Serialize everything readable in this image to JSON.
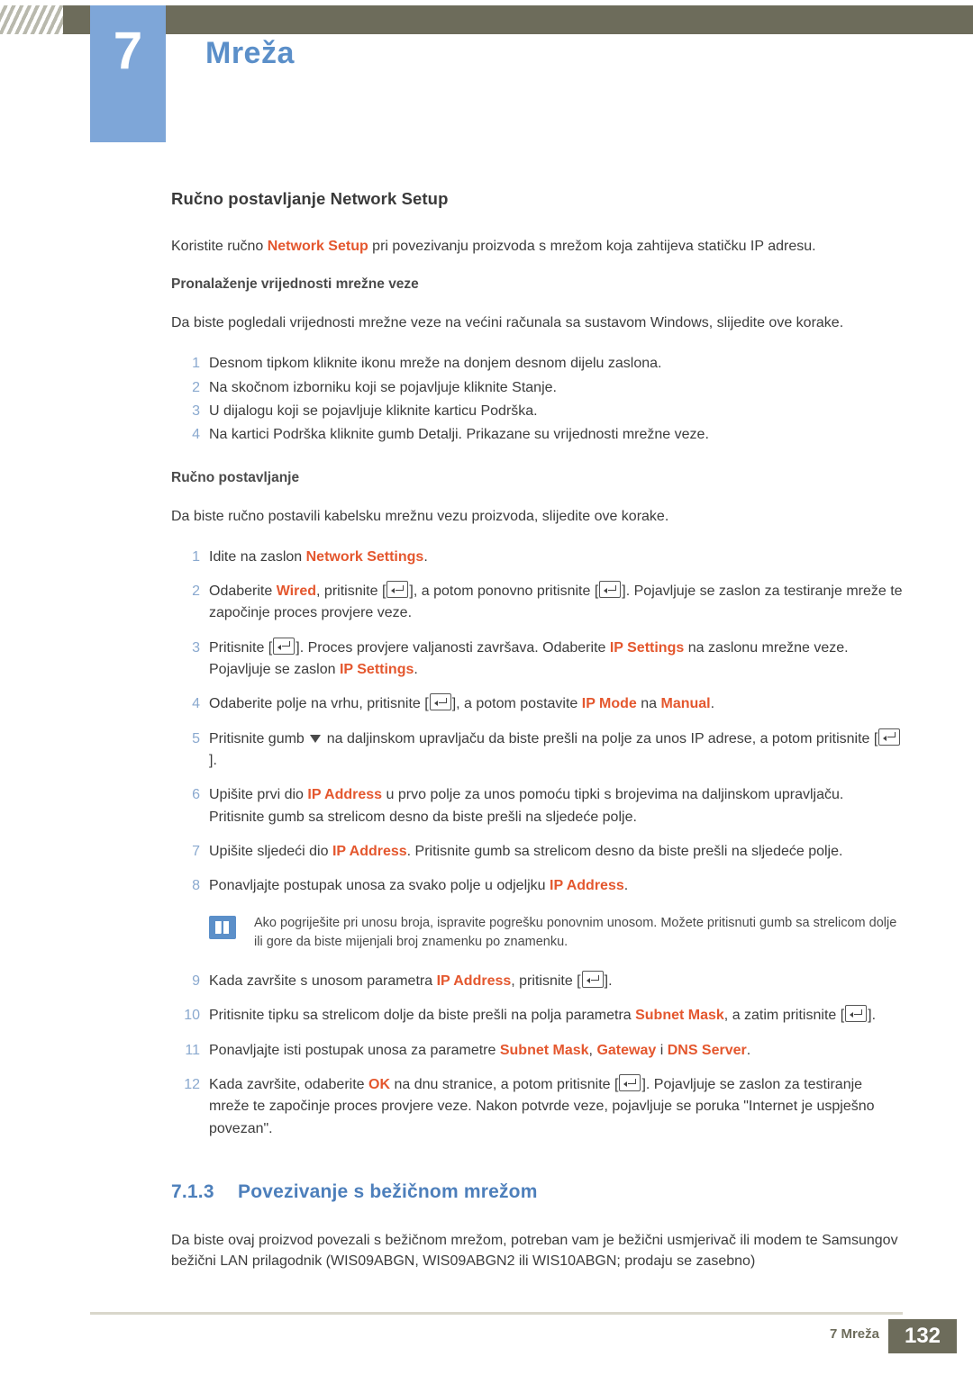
{
  "header": {
    "chapter_number": "7",
    "chapter_title": "Mreža"
  },
  "section": {
    "title": "Ručno postavljanje Network Setup",
    "intro_a": "Koristite ručno ",
    "intro_link": "Network Setup",
    "intro_b": " pri povezivanju proizvoda s mrežom koja zahtijeva statičku IP adresu."
  },
  "sub1": {
    "title": "Pronalaženje vrijednosti mrežne veze",
    "lead": "Da biste pogledali vrijednosti mrežne veze na većini računala sa sustavom Windows, slijedite ove korake.",
    "steps": [
      {
        "num": "1",
        "text": "Desnom tipkom kliknite ikonu mreže na donjem desnom dijelu zaslona."
      },
      {
        "num": "2",
        "text": "Na skočnom izborniku koji se pojavljuje kliknite Stanje."
      },
      {
        "num": "3",
        "text": "U dijalogu koji se pojavljuje kliknite karticu Podrška."
      },
      {
        "num": "4",
        "text": "Na kartici Podrška kliknite gumb Detalji. Prikazane su vrijednosti mrežne veze."
      }
    ]
  },
  "sub2": {
    "title": "Ručno postavljanje",
    "lead": "Da biste ručno postavili kabelsku mrežnu vezu proizvoda, slijedite ove korake.",
    "steps": [
      {
        "num": "1",
        "parts": [
          {
            "t": "Idite na zaslon ",
            "s": "plain"
          },
          {
            "t": "Network Settings",
            "s": "orange"
          },
          {
            "t": ".",
            "s": "plain"
          }
        ]
      },
      {
        "num": "2",
        "parts": [
          {
            "t": "Odaberite ",
            "s": "plain"
          },
          {
            "t": "Wired",
            "s": "orange"
          },
          {
            "t": ", pritisnite [",
            "s": "plain"
          },
          {
            "t": "",
            "s": "key"
          },
          {
            "t": "], a potom ponovno pritisnite [",
            "s": "plain"
          },
          {
            "t": "",
            "s": "key"
          },
          {
            "t": "]. Pojavljuje se zaslon za testiranje mreže te započinje proces provjere veze.",
            "s": "plain"
          }
        ]
      },
      {
        "num": "3",
        "parts": [
          {
            "t": "Pritisnite [",
            "s": "plain"
          },
          {
            "t": "",
            "s": "key"
          },
          {
            "t": "]. Proces provjere valjanosti završava. Odaberite ",
            "s": "plain"
          },
          {
            "t": "IP Settings",
            "s": "orange"
          },
          {
            "t": " na zaslonu mrežne veze. Pojavljuje se zaslon ",
            "s": "plain"
          },
          {
            "t": "IP Settings",
            "s": "orange"
          },
          {
            "t": ".",
            "s": "plain"
          }
        ]
      },
      {
        "num": "4",
        "parts": [
          {
            "t": "Odaberite polje na vrhu, pritisnite [",
            "s": "plain"
          },
          {
            "t": "",
            "s": "key"
          },
          {
            "t": "], a potom postavite ",
            "s": "plain"
          },
          {
            "t": "IP Mode",
            "s": "orange"
          },
          {
            "t": " na ",
            "s": "plain"
          },
          {
            "t": "Manual",
            "s": "orange"
          },
          {
            "t": ".",
            "s": "plain"
          }
        ]
      },
      {
        "num": "5",
        "parts": [
          {
            "t": "Pritisnite gumb ",
            "s": "plain"
          },
          {
            "t": "",
            "s": "down"
          },
          {
            "t": " na daljinskom upravljaču da biste prešli na polje za unos IP adrese, a potom pritisnite [",
            "s": "plain"
          },
          {
            "t": "",
            "s": "key"
          },
          {
            "t": "].",
            "s": "plain"
          }
        ]
      },
      {
        "num": "6",
        "parts": [
          {
            "t": "Upišite prvi dio ",
            "s": "plain"
          },
          {
            "t": "IP Address",
            "s": "orange"
          },
          {
            "t": " u prvo polje za unos pomoću tipki s brojevima na daljinskom upravljaču. Pritisnite gumb sa strelicom desno da biste prešli na sljedeće polje.",
            "s": "plain"
          }
        ]
      },
      {
        "num": "7",
        "parts": [
          {
            "t": "Upišite sljedeći dio ",
            "s": "plain"
          },
          {
            "t": "IP Address",
            "s": "orange"
          },
          {
            "t": ". Pritisnite gumb sa strelicom desno da biste prešli na sljedeće polje.",
            "s": "plain"
          }
        ]
      },
      {
        "num": "8",
        "parts": [
          {
            "t": "Ponavljajte postupak unosa za svako polje u odjeljku ",
            "s": "plain"
          },
          {
            "t": "IP Address",
            "s": "orange"
          },
          {
            "t": ".",
            "s": "plain"
          }
        ]
      }
    ],
    "note": "Ako pogriješite pri unosu broja, ispravite pogrešku ponovnim unosom. Možete pritisnuti gumb sa strelicom dolje ili gore da biste mijenjali broj znamenku po znamenku.",
    "steps2": [
      {
        "num": "9",
        "parts": [
          {
            "t": "Kada završite s unosom parametra ",
            "s": "plain"
          },
          {
            "t": "IP Address",
            "s": "orange"
          },
          {
            "t": ", pritisnite [",
            "s": "plain"
          },
          {
            "t": "",
            "s": "key"
          },
          {
            "t": "].",
            "s": "plain"
          }
        ]
      },
      {
        "num": "10",
        "parts": [
          {
            "t": "Pritisnite tipku sa strelicom dolje da biste prešli na polja parametra ",
            "s": "plain"
          },
          {
            "t": "Subnet Mask",
            "s": "orange"
          },
          {
            "t": ", a zatim pritisnite [",
            "s": "plain"
          },
          {
            "t": "",
            "s": "key"
          },
          {
            "t": "].",
            "s": "plain"
          }
        ]
      },
      {
        "num": "11",
        "parts": [
          {
            "t": "Ponavljajte isti postupak unosa za parametre ",
            "s": "plain"
          },
          {
            "t": "Subnet Mask",
            "s": "orange"
          },
          {
            "t": ", ",
            "s": "plain"
          },
          {
            "t": "Gateway",
            "s": "orange"
          },
          {
            "t": " i ",
            "s": "plain"
          },
          {
            "t": "DNS Server",
            "s": "orange"
          },
          {
            "t": ".",
            "s": "plain"
          }
        ]
      },
      {
        "num": "12",
        "parts": [
          {
            "t": "Kada završite, odaberite ",
            "s": "plain"
          },
          {
            "t": "OK",
            "s": "orange"
          },
          {
            "t": " na dnu stranice, a potom pritisnite [",
            "s": "plain"
          },
          {
            "t": "",
            "s": "key"
          },
          {
            "t": "]. Pojavljuje se zaslon za testiranje mreže te započinje proces provjere veze. Nakon potvrde veze, pojavljuje se poruka \"Internet je uspješno povezan\".",
            "s": "plain"
          }
        ]
      }
    ]
  },
  "section3": {
    "number": "7.1.3",
    "title": "Povezivanje s bežičnom mrežom",
    "para1": "Da biste ovaj proizvod povezali s bežičnom mrežom, potreban vam je bežični usmjerivač ili modem te Samsungov bežični LAN prilagodnik (WIS09ABGN, WIS09ABGN2 ili WIS10ABGN; prodaju se zasebno)"
  },
  "footer": {
    "label": "7 Mreža",
    "page": "132"
  },
  "colors": {
    "accent_blue": "#5b8fc9",
    "chapter_block": "#7ea6d8",
    "orange": "#e4572e",
    "header_bar": "#6d6c5b",
    "step_num": "#8aa9cf"
  }
}
